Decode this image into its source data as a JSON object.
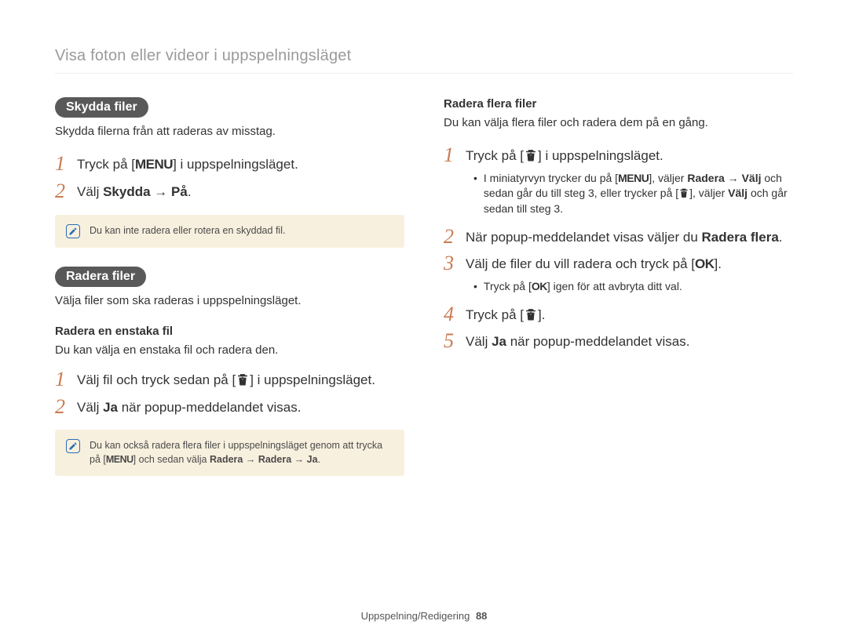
{
  "header": {
    "breadcrumb": "Visa foton eller videor i uppspelningsläget"
  },
  "left": {
    "protect": {
      "pill": "Skydda filer",
      "intro": "Skydda filerna från att raderas av misstag.",
      "step1_a": "Tryck på [",
      "step1_key": "MENU",
      "step1_b": "] i uppspelningsläget.",
      "step2_a": "Välj ",
      "step2_b": "Skydda",
      "step2_c": " → ",
      "step2_d": "På",
      "step2_e": ".",
      "note": "Du kan inte radera eller rotera en skyddad fil."
    },
    "delete": {
      "pill": "Radera filer",
      "intro": "Välja filer som ska raderas i uppspelningsläget.",
      "single_heading": "Radera en enstaka fil",
      "single_intro": "Du kan välja en enstaka fil och radera den.",
      "s1_a": "Välj fil och tryck sedan på [",
      "s1_b": "] i uppspelningsläget.",
      "s2_a": "Välj ",
      "s2_b": "Ja",
      "s2_c": " när popup-meddelandet visas.",
      "note_a": "Du kan också radera flera filer i uppspelningsläget genom att trycka på [",
      "note_key": "MENU",
      "note_b": "] och sedan välja ",
      "note_r1": "Radera",
      "note_r2": "Radera",
      "note_r3": "Ja",
      "note_sep": " → "
    }
  },
  "right": {
    "multi_heading": "Radera flera filer",
    "multi_intro": "Du kan välja flera filer och radera dem på en gång.",
    "s1_a": "Tryck på [",
    "s1_b": "] i uppspelningsläget.",
    "s1_sub_a": "I miniatyrvyn trycker du på [",
    "s1_sub_key": "MENU",
    "s1_sub_b": "], väljer ",
    "s1_sub_rad": "Radera",
    "s1_sub_c": " → ",
    "s1_sub_valj": "Välj",
    "s1_sub_d": " och sedan går du till steg 3, eller trycker på [",
    "s1_sub_e": "], väljer ",
    "s1_sub_valj2": "Välj",
    "s1_sub_f": " och går sedan till steg 3.",
    "s2_a": "När popup-meddelandet visas väljer du ",
    "s2_b": "Radera flera",
    "s2_c": ".",
    "s3_a": "Välj de filer du vill radera och tryck på [",
    "s3_ok": "OK",
    "s3_b": "].",
    "s3_sub_a": "Tryck på [",
    "s3_sub_ok": "OK",
    "s3_sub_b": "] igen för att avbryta ditt val.",
    "s4_a": "Tryck på [",
    "s4_b": "].",
    "s5_a": "Välj ",
    "s5_b": "Ja",
    "s5_c": " när popup-meddelandet visas."
  },
  "footer": {
    "section": "Uppspelning/Redigering",
    "page": "88"
  }
}
